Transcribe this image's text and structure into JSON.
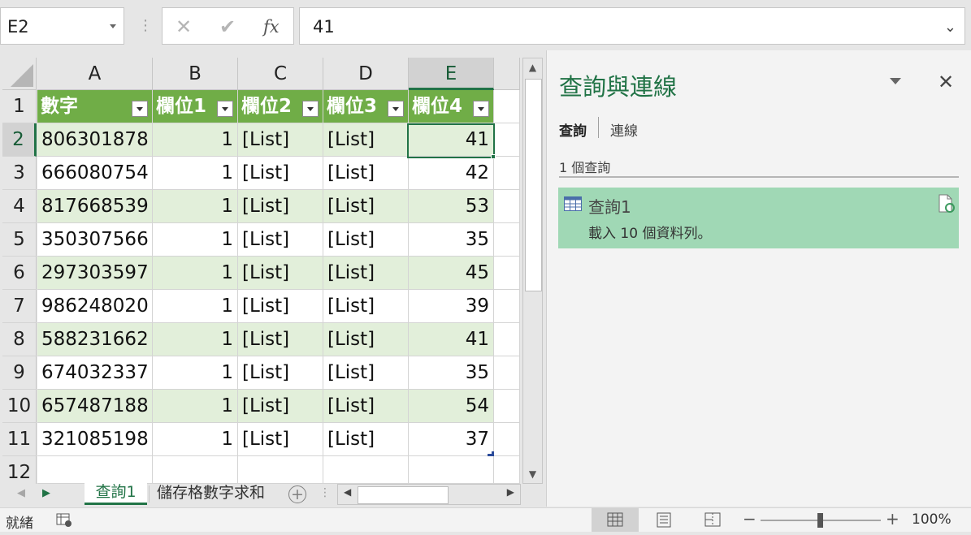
{
  "formula_bar": {
    "name_box": "E2",
    "cancel_icon": "✕",
    "enter_icon": "✔",
    "fx_icon": "fx",
    "formula_value": "41"
  },
  "grid": {
    "columns": [
      "A",
      "B",
      "C",
      "D",
      "E"
    ],
    "rows": [
      "1",
      "2",
      "3",
      "4",
      "5",
      "6",
      "7",
      "8",
      "9",
      "10",
      "11",
      "12"
    ],
    "selected_column": "E",
    "selected_row": "2",
    "table_headers": [
      "數字",
      "欄位1",
      "欄位2",
      "欄位3",
      "欄位4"
    ],
    "table_rows": [
      [
        "806301878",
        "1",
        "[List]",
        "[List]",
        "41"
      ],
      [
        "666080754",
        "1",
        "[List]",
        "[List]",
        "42"
      ],
      [
        "817668539",
        "1",
        "[List]",
        "[List]",
        "53"
      ],
      [
        "350307566",
        "1",
        "[List]",
        "[List]",
        "35"
      ],
      [
        "297303597",
        "1",
        "[List]",
        "[List]",
        "45"
      ],
      [
        "986248020",
        "1",
        "[List]",
        "[List]",
        "39"
      ],
      [
        "588231662",
        "1",
        "[List]",
        "[List]",
        "41"
      ],
      [
        "674032337",
        "1",
        "[List]",
        "[List]",
        "35"
      ],
      [
        "657487188",
        "1",
        "[List]",
        "[List]",
        "54"
      ],
      [
        "321085198",
        "1",
        "[List]",
        "[List]",
        "37"
      ]
    ]
  },
  "sheet_tabs": {
    "tabs": [
      "查詢1",
      "儲存格數字求和"
    ],
    "active": "查詢1",
    "tab2_display": "儲存格數字求和",
    "add_label": "+"
  },
  "pane": {
    "title": "查詢與連線",
    "tab_queries": "查詢",
    "tab_connections": "連線",
    "query_count": "1 個查詢",
    "query_name": "查詢1",
    "query_status": "載入 10 個資料列。"
  },
  "status_bar": {
    "ready": "就緒",
    "zoom": "100%"
  },
  "colors": {
    "header_green": "#70ad47",
    "band_green": "#e2efda",
    "accent": "#217346",
    "query_card": "#a0d8b5"
  }
}
